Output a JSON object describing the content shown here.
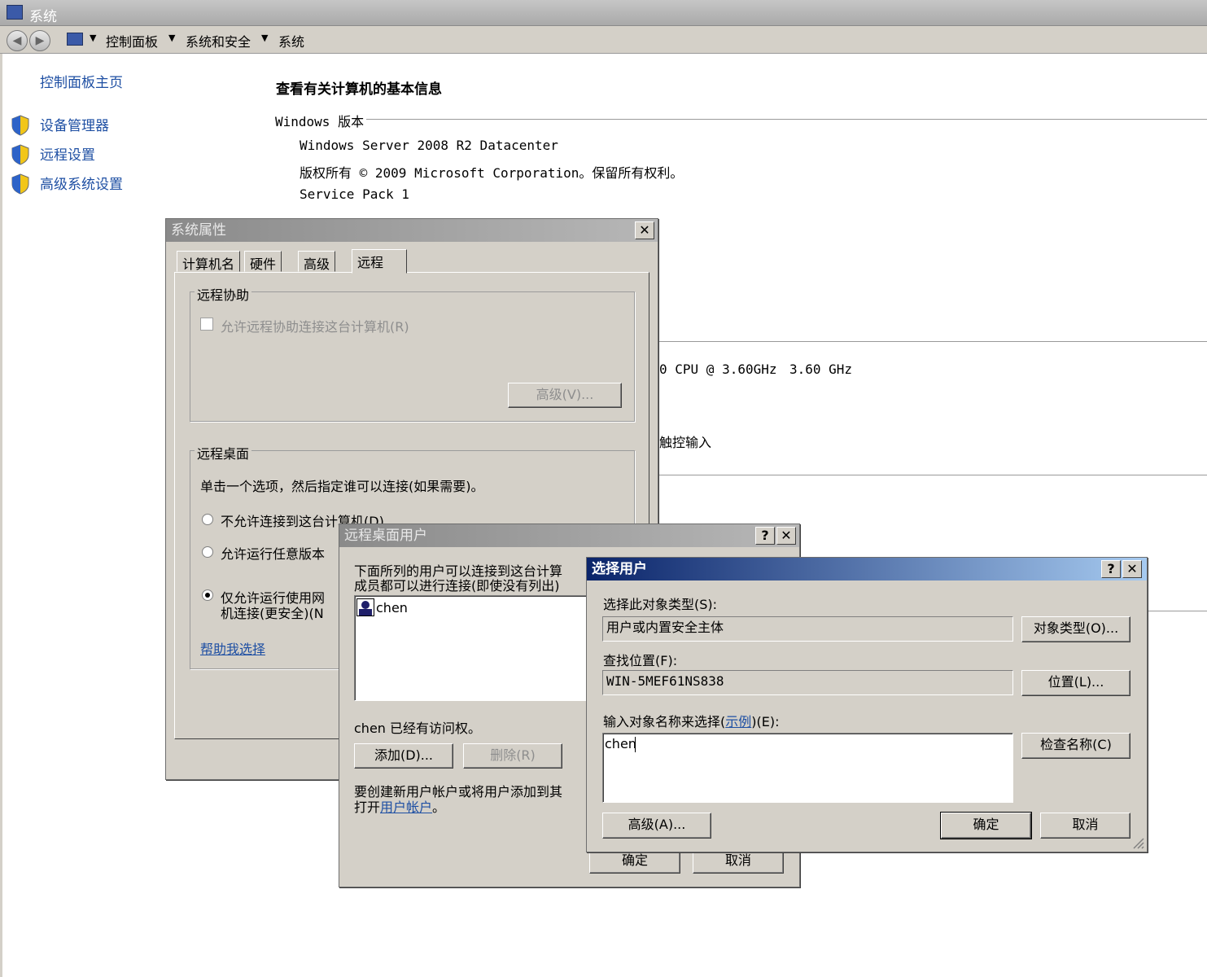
{
  "main_window": {
    "title": "系统",
    "breadcrumb": [
      "控制面板",
      "系统和安全",
      "系统"
    ]
  },
  "sidebar": {
    "home_link": "控制面板主页",
    "items": [
      {
        "label": "设备管理器",
        "icon": "shield-icon"
      },
      {
        "label": "远程设置",
        "icon": "shield-icon"
      },
      {
        "label": "高级系统设置",
        "icon": "shield-icon"
      }
    ]
  },
  "content": {
    "heading": "查看有关计算机的基本信息",
    "windows_edition_label": "Windows 版本",
    "edition": "Windows Server 2008 R2 Datacenter",
    "copyright": "版权所有 © 2009 Microsoft Corporation。保留所有权利。",
    "service_pack": "Service Pack 1",
    "cpu_fragment": "0 CPU @ 3.60GHz",
    "cpu_speed": "3.60 GHz",
    "touch_fragment": "触控输入"
  },
  "system_properties": {
    "title": "系统属性",
    "tabs": [
      "计算机名",
      "硬件",
      "高级",
      "远程"
    ],
    "active_tab": "远程",
    "remote_assistance": {
      "group_label": "远程协助",
      "checkbox_label": "允许远程协助连接这台计算机(R)",
      "advanced_button": "高级(V)..."
    },
    "remote_desktop": {
      "group_label": "远程桌面",
      "instruction": "单击一个选项，然后指定谁可以连接(如果需要)。",
      "option1": "不允许连接到这台计算机(D)",
      "option2": "允许运行任意版本",
      "option3_line1": "仅允许运行使用网",
      "option3_line2": "机连接(更安全)(N",
      "help_link": "帮助我选择"
    }
  },
  "remote_desktop_users": {
    "title": "远程桌面用户",
    "desc_line1": "下面所列的用户可以连接到这台计算",
    "desc_line2": "成员都可以进行连接(即使没有列出)",
    "users": [
      "chen"
    ],
    "access_note": "chen 已经有访问权。",
    "add_button": "添加(D)...",
    "remove_button": "删除(R)",
    "create_line1": "要创建新用户帐户或将用户添加到其",
    "create_line2_prefix": "打开",
    "create_link": "用户帐户",
    "create_line2_suffix": "。",
    "ok_button": "确定",
    "cancel_button": "取消"
  },
  "select_users": {
    "title": "选择用户",
    "object_type_label": "选择此对象类型(S):",
    "object_type_value": "用户或内置安全主体",
    "object_type_button": "对象类型(O)...",
    "location_label": "查找位置(F):",
    "location_value": "WIN-5MEF61NS838",
    "location_button": "位置(L)...",
    "enter_names_prefix": "输入对象名称来选择(",
    "examples_link": "示例",
    "enter_names_suffix": ")(E):",
    "names_value": "chen",
    "check_names_button": "检查名称(C)",
    "advanced_button": "高级(A)...",
    "ok_button": "确定",
    "cancel_button": "取消"
  }
}
